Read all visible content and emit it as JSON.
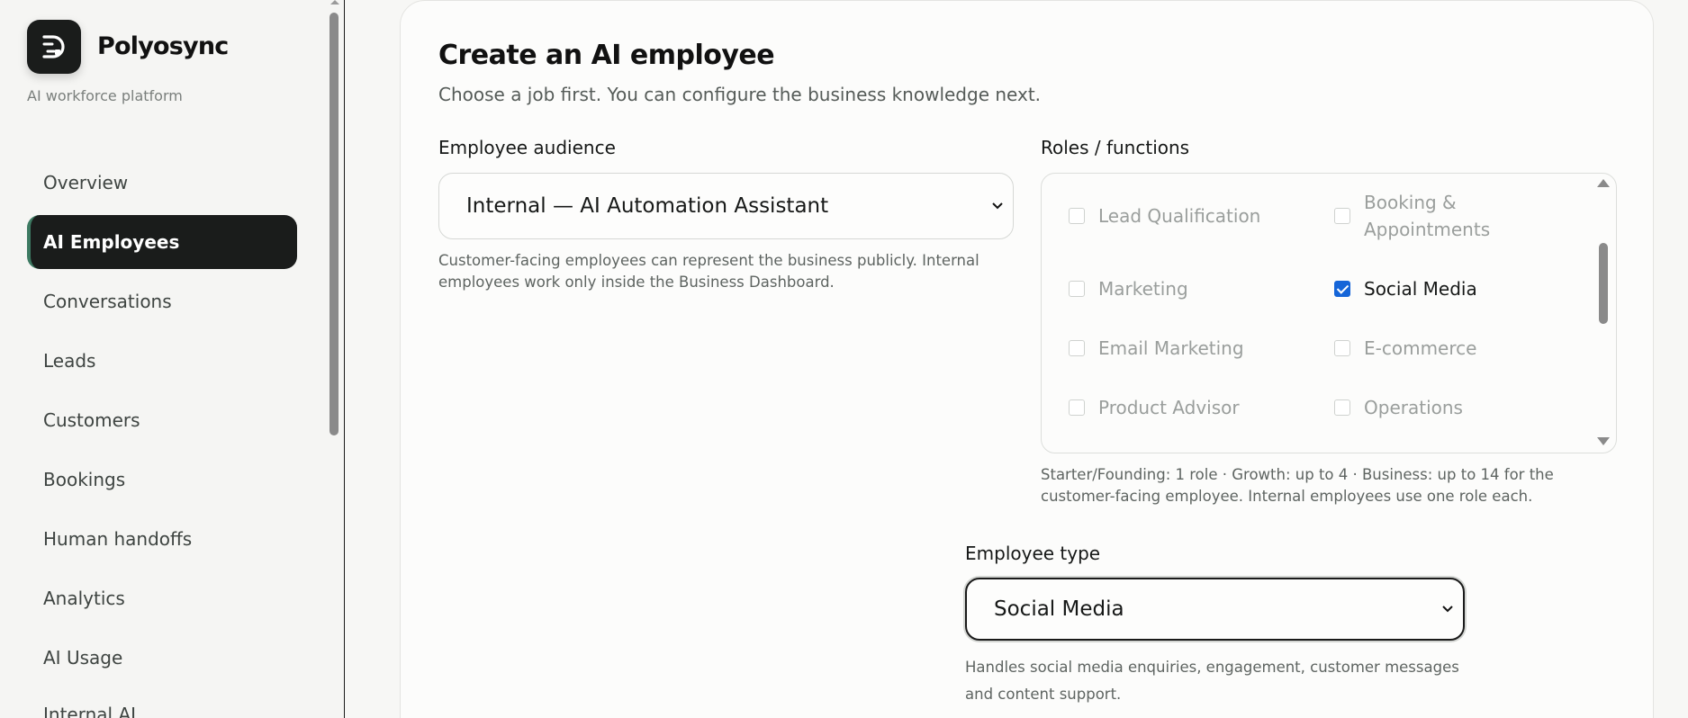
{
  "brand": {
    "name": "Polyosync",
    "tagline": "AI workforce platform",
    "logo_icon": "polyosync-logo-icon"
  },
  "sidebar": {
    "items": [
      {
        "label": "Overview",
        "active": false
      },
      {
        "label": "AI Employees",
        "active": true
      },
      {
        "label": "Conversations",
        "active": false
      },
      {
        "label": "Leads",
        "active": false
      },
      {
        "label": "Customers",
        "active": false
      },
      {
        "label": "Bookings",
        "active": false
      },
      {
        "label": "Human handoffs",
        "active": false
      },
      {
        "label": "Analytics",
        "active": false
      },
      {
        "label": "AI Usage",
        "active": false
      },
      {
        "label": "Internal AI",
        "active": false
      }
    ]
  },
  "page": {
    "title": "Create an AI employee",
    "subtitle": "Choose a job first. You can configure the business knowledge next."
  },
  "audience": {
    "label": "Employee audience",
    "selected": "Internal — AI Automation Assistant",
    "help": "Customer-facing employees can represent the business publicly. Internal employees work only inside the Business Dashboard."
  },
  "roles": {
    "label": "Roles / functions",
    "items": [
      {
        "label": "Lead Qualification",
        "checked": false
      },
      {
        "label": "Booking & Appointments",
        "checked": false
      },
      {
        "label": "Marketing",
        "checked": false
      },
      {
        "label": "Social Media",
        "checked": true
      },
      {
        "label": "Email Marketing",
        "checked": false
      },
      {
        "label": "E-commerce",
        "checked": false
      },
      {
        "label": "Product Advisor",
        "checked": false
      },
      {
        "label": "Operations",
        "checked": false
      }
    ],
    "help": "Starter/Founding: 1 role · Growth: up to 4 · Business: up to 14 for the customer-facing employee. Internal employees use one role each."
  },
  "employee_type": {
    "label": "Employee type",
    "selected": "Social Media",
    "help": "Handles social media enquiries, engagement, customer messages and content support."
  },
  "colors": {
    "accent_active": "#1a1c1b",
    "active_marker": "#3d7a62",
    "checkbox_checked": "#1565d8"
  }
}
